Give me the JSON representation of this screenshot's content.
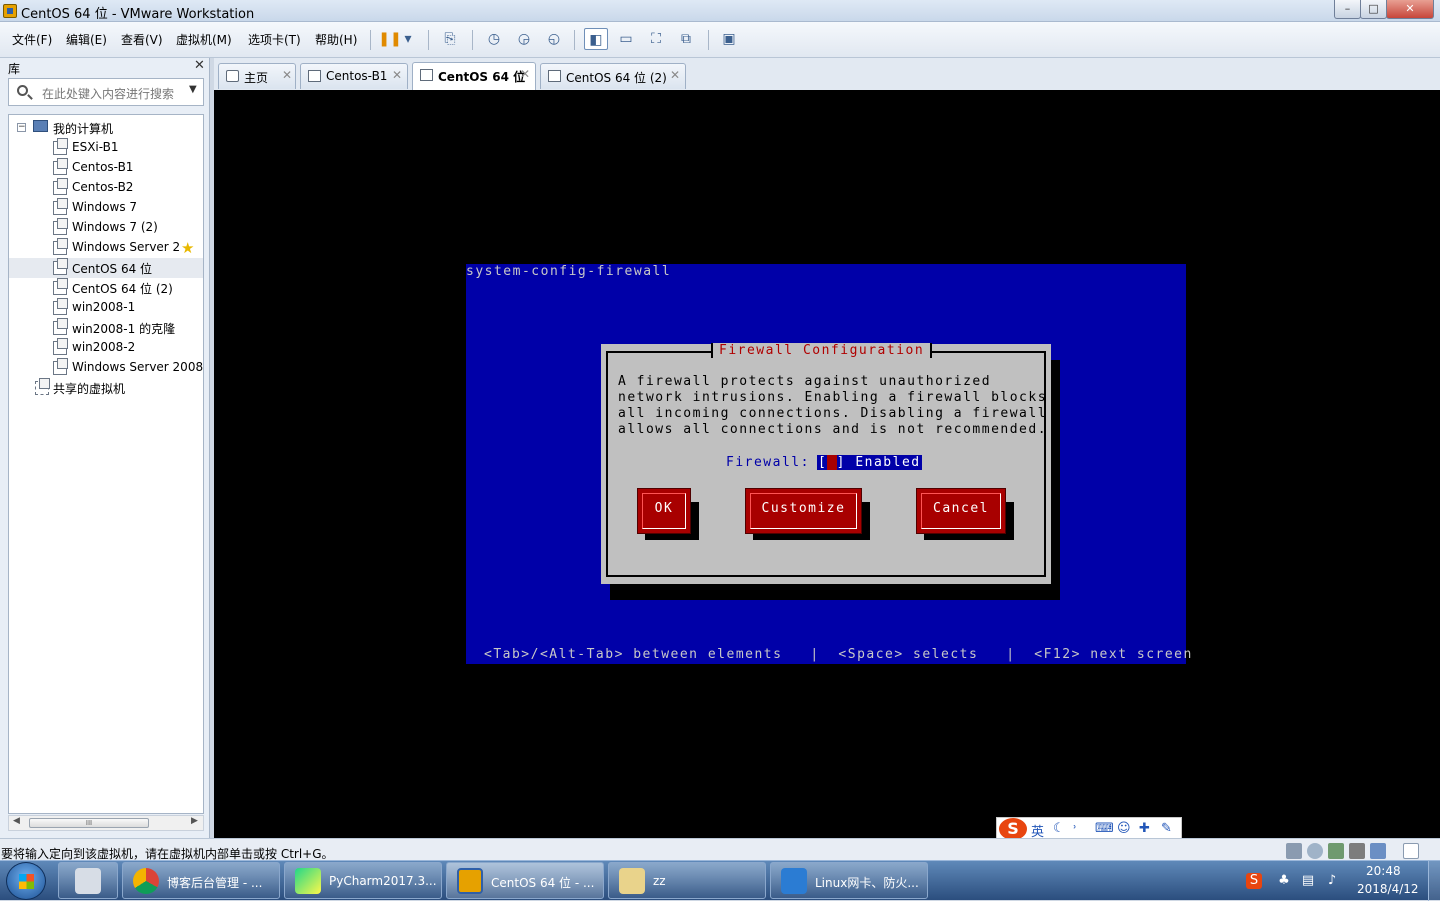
{
  "window": {
    "title": "CentOS 64 位 - VMware Workstation",
    "minimize": "–",
    "maximize": "□",
    "close": "✕"
  },
  "menu": [
    "文件(F)",
    "编辑(E)",
    "查看(V)",
    "虚拟机(M)",
    "选项卡(T)",
    "帮助(H)"
  ],
  "toolbar": {
    "pause_icon": "pause-icon",
    "dropdown": "▾"
  },
  "library": {
    "title": "库",
    "close": "✕",
    "search_placeholder": "在此处键入内容进行搜索",
    "tree": {
      "root": "我的计算机",
      "items": [
        "ESXi-B1",
        "Centos-B1",
        "Centos-B2",
        "Windows 7",
        "Windows 7 (2)",
        "Windows Server 2",
        "CentOS 64 位",
        "CentOS 64 位 (2)",
        "win2008-1",
        "win2008-1 的克隆",
        "win2008-2",
        "Windows Server 2008"
      ],
      "shared": "共享的虚拟机",
      "selected": "CentOS 64 位",
      "starred": "Windows Server 2"
    }
  },
  "tabs": [
    {
      "label": "主页"
    },
    {
      "label": "Centos-B1"
    },
    {
      "label": "CentOS 64 位",
      "active": true
    },
    {
      "label": "CentOS 64 位 (2)"
    }
  ],
  "console": {
    "header": "system-config-firewall",
    "dialog": {
      "title": "Firewall Configuration",
      "body": "A firewall protects against unauthorized\nnetwork intrusions. Enabling a firewall blocks\nall incoming connections. Disabling a firewall\nallows all connections and is not recommended.",
      "field_label": "Firewall:",
      "checkbox_open": "[",
      "checkbox_mark": "*",
      "checkbox_close": "]",
      "checkbox_text": "Enabled",
      "checked": true,
      "buttons": {
        "ok": "OK",
        "customize": "Customize",
        "cancel": "Cancel"
      }
    },
    "help": "<Tab>/<Alt-Tab> between elements   |  <Space> selects   |  <F12> next screen"
  },
  "ime": {
    "logo": "S",
    "mode": "英"
  },
  "status": {
    "text": "要将输入定向到该虚拟机，请在虚拟机内部单击或按 Ctrl+G。"
  },
  "taskbar": {
    "items": [
      {
        "label": "博客后台管理 - ..."
      },
      {
        "label": "PyCharm2017.3..."
      },
      {
        "label": "CentOS 64 位 - ...",
        "active": true
      },
      {
        "label": "zz"
      },
      {
        "label": "Linux网卡、防火..."
      }
    ],
    "time": "20:48",
    "date": "2018/4/12"
  },
  "colors": {
    "tui_background": "#0000a8",
    "dialog_background": "#c0c0c0",
    "button_red": "#a80000",
    "dialog_title": "#b00000"
  }
}
